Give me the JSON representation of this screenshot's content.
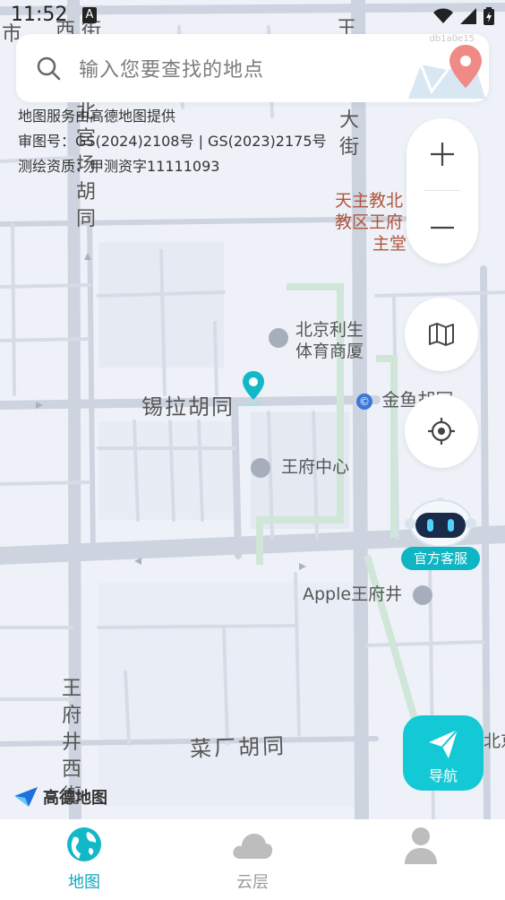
{
  "status_bar": {
    "time": "11:52",
    "notification_letter": "A"
  },
  "search": {
    "placeholder": "输入您要查找的地点",
    "hint": "db1a0e15"
  },
  "map_info": {
    "line1": "地图服务由高德地图提供",
    "line2": "审图号：GS(2024)2108号 | GS(2023)2175号",
    "line3": "测绘资质：甲测资字11111093"
  },
  "map_labels": {
    "top_left_fragment": "市",
    "top_road": "西 街",
    "top_right_char": "王",
    "da_jie": "大街",
    "church": "天主教北京教区王府井堂",
    "church_lines": [
      "天主教北",
      "教区王府",
      "主堂"
    ],
    "beijing_lisheng": [
      "北京利生",
      "体育商厦"
    ],
    "xila_hutong": "锡拉胡同",
    "jinyu_hutong": "金鱼胡同",
    "wangfu_center": "王府中心",
    "apple_store": "Apple王府井",
    "caichang_hutong": "菜厂胡同",
    "bei_guanfang_hutong": "北官场胡同",
    "wangfujing_west": "王府井西街",
    "bei_right": "北京"
  },
  "map_controls": {
    "zoom_in": "+",
    "zoom_out": "−",
    "layers_icon": "map-icon",
    "locate_icon": "locate-icon"
  },
  "assistant": {
    "label": "官方客服"
  },
  "navigation": {
    "label": "导航"
  },
  "amap_logo": {
    "text": "高德地图"
  },
  "tabs": [
    {
      "label": "地图",
      "icon": "globe-icon",
      "active": true
    },
    {
      "label": "云层",
      "icon": "cloud-icon",
      "active": false
    },
    {
      "label": "",
      "icon": "user-icon",
      "active": false
    }
  ],
  "colors": {
    "accent": "#13c9d6",
    "tab_active": "#0ea8c0",
    "tab_inactive": "#9a9a9a",
    "map_bg": "#eef2f8",
    "road": "#c8d0dc"
  }
}
